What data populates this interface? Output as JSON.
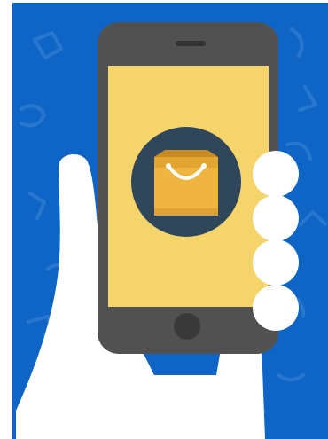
{
  "illustration": {
    "subject": "smartphone-with-shopping-bag",
    "colors": {
      "background": "#0f65c6",
      "doodle": "#2a7ad1",
      "phone_body": "#525151",
      "screen": "#f6d46c",
      "circle": "#30465a",
      "bag_front": "#f0b541",
      "bag_back": "#d89b29",
      "hand": "#ffffff",
      "button": "#3a3939"
    },
    "icons": [
      "shopping-bag-icon",
      "home-button-icon",
      "speaker-icon"
    ]
  }
}
